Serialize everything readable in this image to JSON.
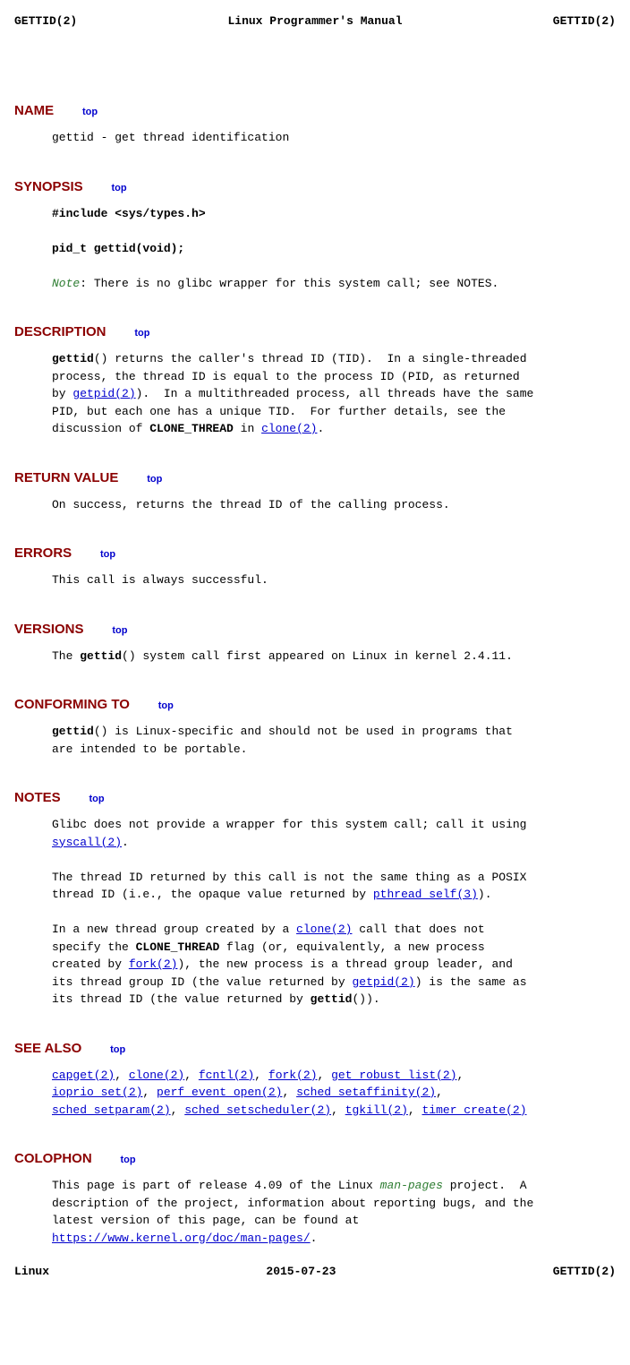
{
  "header": {
    "left": "GETTID(2)",
    "center": "Linux Programmer's Manual",
    "right": "GETTID(2)"
  },
  "footer": {
    "left": "Linux",
    "center": "2015-07-23",
    "right": "GETTID(2)"
  },
  "toplink": "top",
  "sections": {
    "name": {
      "title": "NAME",
      "desc": "gettid - get thread identification"
    },
    "synopsis": {
      "title": "SYNOPSIS",
      "include": "#include <sys/types.h>",
      "proto": "pid_t gettid(void);",
      "note_lbl": "Note",
      "note_txt": ": There is no glibc wrapper for this system call; see NOTES."
    },
    "description": {
      "title": "DESCRIPTION",
      "fn": "gettid",
      "t1": "() returns the caller's thread ID (TID).  In a single-threaded\nprocess, the thread ID is equal to the process ID (PID, as returned\nby ",
      "l1": "getpid(2)",
      "t2": ").  In a multithreaded process, all threads have the same\nPID, but each one has a unique TID.  For further details, see the\ndiscussion of ",
      "ct": "CLONE_THREAD",
      "t3": " in ",
      "l2": "clone(2)",
      "t4": "."
    },
    "retval": {
      "title": "RETURN VALUE",
      "txt": "On success, returns the thread ID of the calling process."
    },
    "errors": {
      "title": "ERRORS",
      "txt": "This call is always successful."
    },
    "versions": {
      "title": "VERSIONS",
      "t1": "The ",
      "fn": "gettid",
      "t2": "() system call first appeared on Linux in kernel 2.4.11."
    },
    "conforming": {
      "title": "CONFORMING TO",
      "fn": "gettid",
      "t1": "() is Linux-specific and should not be used in programs that\nare intended to be portable."
    },
    "notes": {
      "title": "NOTES",
      "p1a": "Glibc does not provide a wrapper for this system call; call it using\n",
      "l1": "syscall(2)",
      "p1b": ".",
      "p2a": "The thread ID returned by this call is not the same thing as a POSIX\nthread ID (i.e., the opaque value returned by ",
      "l2": "pthread_self(3)",
      "p2b": ").",
      "p3a": "In a new thread group created by a ",
      "l3": "clone(2)",
      "p3b": " call that does not\nspecify the ",
      "ct": "CLONE_THREAD",
      "p3c": " flag (or, equivalently, a new process\ncreated by ",
      "l4": "fork(2)",
      "p3d": "), the new process is a thread group leader, and\nits thread group ID (the value returned by ",
      "l5": "getpid(2)",
      "p3e": ") is the same as\nits thread ID (the value returned by ",
      "fn": "gettid",
      "p3f": "())."
    },
    "seealso": {
      "title": "SEE ALSO",
      "links": [
        "capget(2)",
        "clone(2)",
        "fcntl(2)",
        "fork(2)",
        "get_robust_list(2)",
        "ioprio_set(2)",
        "perf_event_open(2)",
        "sched_setaffinity(2)",
        "sched_setparam(2)",
        "sched_setscheduler(2)",
        "tgkill(2)",
        "timer_create(2)"
      ]
    },
    "colophon": {
      "title": "COLOPHON",
      "t1": "This page is part of release 4.09 of the Linux ",
      "mp": "man-pages",
      "t2": " project.  A\ndescription of the project, information about reporting bugs, and the\nlatest version of this page, can be found at\n",
      "url": "https://www.kernel.org/doc/man-pages/",
      "t3": "."
    }
  }
}
